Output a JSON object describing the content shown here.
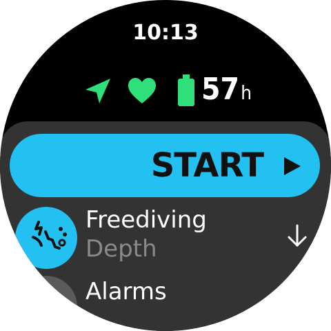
{
  "header": {
    "time": "10:13"
  },
  "status": {
    "icons": [
      "navigation-arrow-icon",
      "heart-icon",
      "battery-icon"
    ],
    "battery_hours": "57",
    "battery_unit": "h"
  },
  "start_button": {
    "label": "START",
    "icon": "play-icon"
  },
  "menu": {
    "items": [
      {
        "title": "Freediving",
        "subtitle": "Depth",
        "icon": "freediving-icon"
      },
      {
        "title": "Alarms",
        "subtitle": "",
        "icon": "alarm-icon"
      }
    ],
    "scroll_hint_icon": "down-arrow-icon"
  },
  "colors": {
    "background": "#000000",
    "accent": "#23c0f2",
    "status_green": "#2fe07a",
    "panel": "#333333",
    "subtitle": "#8a8a8a"
  }
}
